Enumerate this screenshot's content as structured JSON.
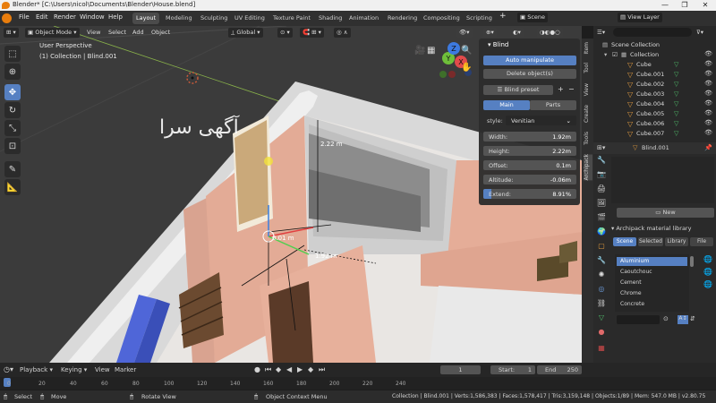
{
  "window": {
    "title": "Blender* [C:\\Users\\nicol\\Documents\\Blender\\House.blend]",
    "controls": [
      "—",
      "❐",
      "✕"
    ]
  },
  "menubar": {
    "items": [
      "File",
      "Edit",
      "Render",
      "Window",
      "Help"
    ],
    "workspace_tabs": [
      "Layout",
      "Modeling",
      "Sculpting",
      "UV Editing",
      "Texture Paint",
      "Shading",
      "Animation",
      "Rendering",
      "Compositing",
      "Scripting"
    ],
    "active_tab": "Layout",
    "add_tab": "+",
    "scene": "Scene",
    "view_layer": "View Layer"
  },
  "viewport_header": {
    "mode": "Object Mode",
    "menus": [
      "View",
      "Select",
      "Add",
      "Object"
    ],
    "orientation": "Global"
  },
  "viewport": {
    "perspective": "User Perspective",
    "collection": "(1) Collection | Blind.001",
    "dimension_labels": [
      "2.22 m",
      "1.92 m",
      "0.01 m"
    ],
    "watermark": "آگهی سرا",
    "gizmo_axes": [
      "Y",
      "X",
      "Z"
    ]
  },
  "blind_panel": {
    "title": "Blind",
    "auto_manipulate": "Auto manipulate",
    "delete_object": "Delete object(s)",
    "preset": "Blind preset",
    "tabs": [
      "Main",
      "Parts"
    ],
    "style_label": "style:",
    "style_value": "Venitian",
    "fields": [
      {
        "label": "Width:",
        "value": "1.92m"
      },
      {
        "label": "Height:",
        "value": "2.22m"
      },
      {
        "label": "Offset:",
        "value": "0.1m"
      },
      {
        "label": "Altitude:",
        "value": "-0.06m"
      },
      {
        "label": "Extend:",
        "value": "8.91%"
      }
    ]
  },
  "npanel_tabs": [
    "Item",
    "Tool",
    "View",
    "Create",
    "Tools",
    "Archipack"
  ],
  "outliner": {
    "root": "Scene Collection",
    "collection": "Collection",
    "objects": [
      "Cube",
      "Cube.001",
      "Cube.002",
      "Cube.003",
      "Cube.004",
      "Cube.005",
      "Cube.006",
      "Cube.007"
    ]
  },
  "properties": {
    "object_name": "Blind.001",
    "new_button": "New",
    "library_title": "Archipack material library",
    "library_tabs": [
      "Scene",
      "Selected",
      "Library",
      "File"
    ],
    "materials": [
      "Aluminium",
      "Caoutchouc",
      "Cement",
      "Chrome",
      "Concrete"
    ]
  },
  "timeline": {
    "menus": [
      "Playback",
      "Keying",
      "View",
      "Marker"
    ],
    "current_frame": "1",
    "start_label": "Start:",
    "start": "1",
    "end_label": "End",
    "end": "250",
    "ticks": [
      "0",
      "20",
      "40",
      "60",
      "80",
      "100",
      "120",
      "140",
      "160",
      "180",
      "200",
      "220",
      "240"
    ]
  },
  "statusbar": {
    "select": "Select",
    "move": "Move",
    "rotate": "Rotate View",
    "context": "Object Context Menu",
    "stats": "Collection | Blind.001 | Verts:1,586,383 | Faces:1,578,417 | Tris:3,159,148 | Objects:1/89 | Mem: 547.0 MB | v2.80.75"
  },
  "colors": {
    "accent": "#5680c2",
    "wall": "#e8b09a",
    "floor": "#ebebeb",
    "object_orange": "#e09a3e",
    "mesh_green": "#4fbd6a"
  }
}
